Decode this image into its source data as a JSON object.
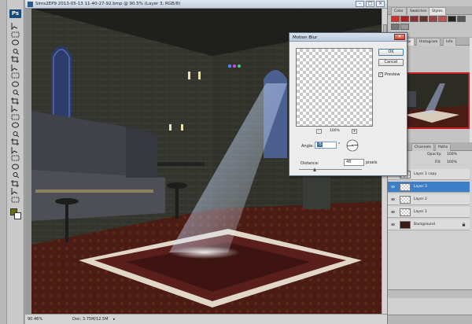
{
  "document": {
    "title": "Sims2EP9 2013-05-13 11-40-27-92.bmp @ 90.5% (Layer 3, RGB/8)",
    "zoom": "90.46%",
    "doc_info": "Doc: 3.75M/12.5M",
    "arrow": "▸"
  },
  "motion_blur": {
    "title": "Motion Blur",
    "close": "✕",
    "ok_label": "OK",
    "cancel_label": "Cancel",
    "preview_label": "Preview",
    "preview_checked": "✓",
    "zoom_minus": "-",
    "zoom_plus": "+",
    "zoom_value": "100%",
    "angle_label": "Angle:",
    "angle_value": "-5",
    "angle_unit": "°",
    "distance_label": "Distance:",
    "distance_value": "48",
    "distance_unit": "pixels"
  },
  "panels": {
    "top_tabs": [
      "Color",
      "Swatches",
      "Styles"
    ],
    "nav_tabs": [
      "Navigator",
      "Histogram",
      "Info"
    ],
    "layer_tabs": [
      "Channels",
      "Paths"
    ],
    "opacity_label": "Opacity:",
    "opacity_value": "100%",
    "fill_label": "Fill:",
    "fill_value": "100%",
    "layers": [
      {
        "name": "Layer 1 copy",
        "selected": false
      },
      {
        "name": "Layer 3",
        "selected": true
      },
      {
        "name": "Layer 2",
        "selected": false
      },
      {
        "name": "Layer 1",
        "selected": false
      },
      {
        "name": "Background",
        "selected": false
      }
    ]
  },
  "colors": {
    "foreground": "#6b6b18",
    "background": "#ffffff",
    "accent_selection": "#3d7fc6",
    "navigator_frame": "#c81d1d"
  },
  "tools": [
    "move-tool-icon",
    "marquee-tool-icon",
    "lasso-tool-icon",
    "quick-select-tool-icon",
    "crop-tool-icon",
    "eyedropper-tool-icon",
    "healing-tool-icon",
    "brush-tool-icon",
    "clone-stamp-tool-icon",
    "history-brush-tool-icon",
    "eraser-tool-icon",
    "gradient-tool-icon",
    "blur-tool-icon",
    "dodge-tool-icon",
    "pen-tool-icon",
    "type-tool-icon",
    "path-select-tool-icon",
    "shape-tool-icon",
    "3d-rotate-tool-icon",
    "3d-orbit-tool-icon",
    "hand-tool-icon",
    "zoom-tool-icon"
  ]
}
